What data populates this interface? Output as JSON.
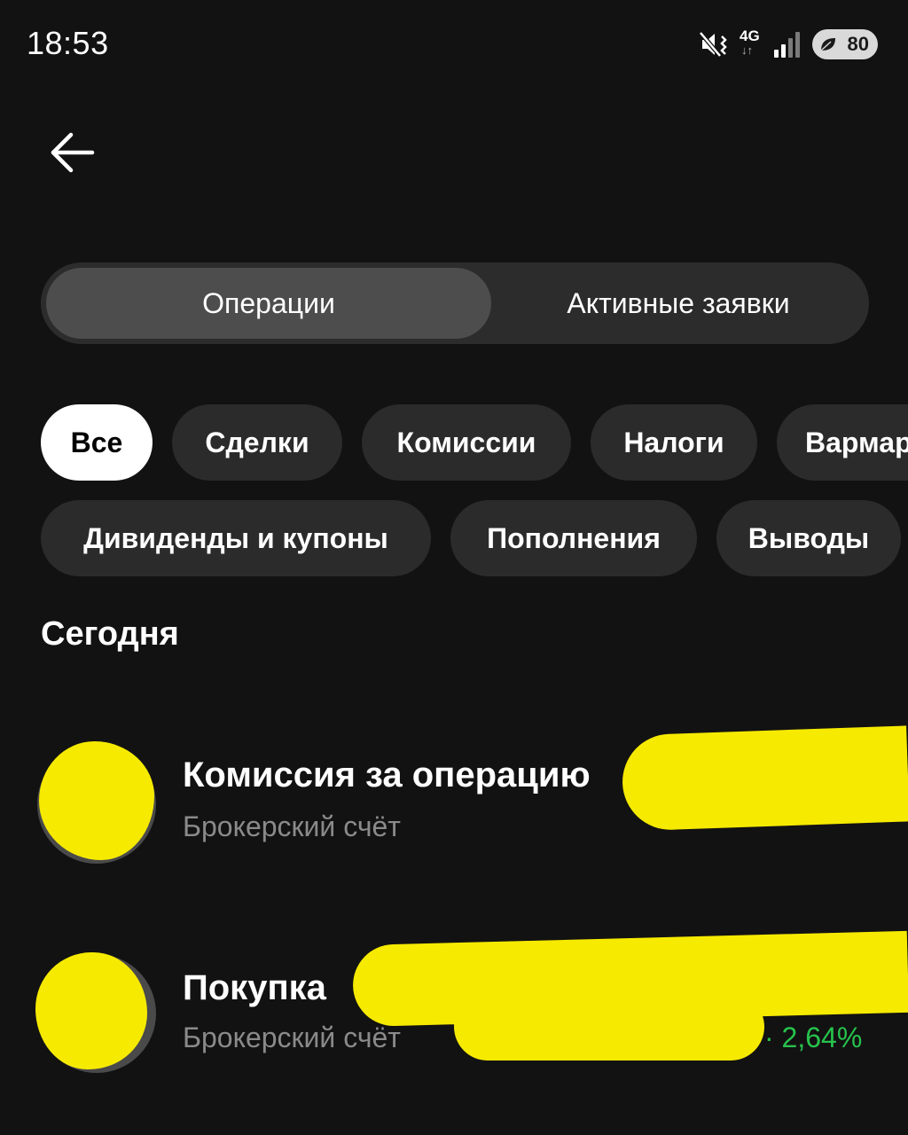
{
  "status_bar": {
    "time": "18:53",
    "network": "4G",
    "network_arrows": "↓↑",
    "battery": "80",
    "icons": [
      "mute-vibrate-icon",
      "signal-bars-icon",
      "battery-leaf-icon"
    ]
  },
  "header": {
    "back_icon": "arrow-left-icon"
  },
  "tabs": [
    {
      "label": "Операции",
      "active": true
    },
    {
      "label": "Активные заявки",
      "active": false
    }
  ],
  "filters": [
    {
      "label": "Все",
      "selected": true
    },
    {
      "label": "Сделки",
      "selected": false
    },
    {
      "label": "Комиссии",
      "selected": false
    },
    {
      "label": "Налоги",
      "selected": false
    },
    {
      "label": "Вармар",
      "selected": false
    },
    {
      "label": "Дивиденды и купоны",
      "selected": false
    },
    {
      "label": "Пополнения",
      "selected": false
    },
    {
      "label": "Выводы",
      "selected": false
    }
  ],
  "section": {
    "title": "Сегодня"
  },
  "operations": [
    {
      "title": "Комиссия за операцию",
      "subtitle": "Брокерский счёт",
      "change": ""
    },
    {
      "title": "Покупка",
      "subtitle": "Брокерский счёт",
      "change": "· 2,64%"
    }
  ],
  "colors": {
    "background": "#121212",
    "chip": "#2b2b2b",
    "chip_selected": "#ffffff",
    "segment_active": "#4d4d4d",
    "positive": "#27c24c",
    "redaction": "#f6ea00"
  }
}
